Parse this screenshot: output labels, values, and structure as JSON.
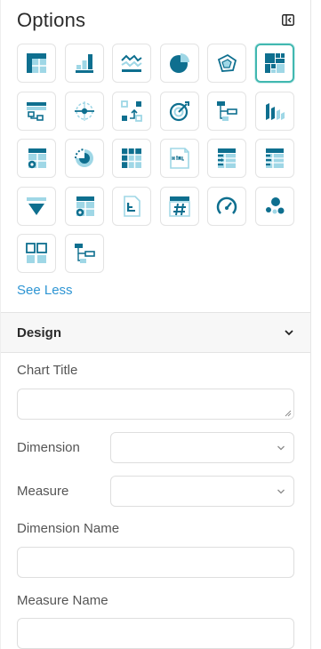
{
  "panel": {
    "title": "Options",
    "collapse_icon": "collapse-panel-icon"
  },
  "chart_types": [
    {
      "icon": "table-icon",
      "selected": false
    },
    {
      "icon": "bar-chart-icon",
      "selected": false
    },
    {
      "icon": "line-chart-icon",
      "selected": false
    },
    {
      "icon": "pie-chart-icon",
      "selected": false
    },
    {
      "icon": "3d-chart-icon",
      "selected": false
    },
    {
      "icon": "treemap-icon",
      "selected": true
    },
    {
      "icon": "table-drilldown-icon",
      "selected": false
    },
    {
      "icon": "radar-chart-icon",
      "selected": false
    },
    {
      "icon": "flow-chart-icon",
      "selected": false
    },
    {
      "icon": "target-chart-icon",
      "selected": false
    },
    {
      "icon": "hierarchy-icon",
      "selected": false
    },
    {
      "icon": "waterfall-3d-icon",
      "selected": false
    },
    {
      "icon": "table-settings-icon",
      "selected": false
    },
    {
      "icon": "radial-chart-icon",
      "selected": false
    },
    {
      "icon": "grid-table-icon",
      "selected": false
    },
    {
      "icon": "html-icon",
      "selected": false
    },
    {
      "icon": "data-table-icon",
      "selected": false
    },
    {
      "icon": "data-table-alt-icon",
      "selected": false
    },
    {
      "icon": "funnel-chart-icon",
      "selected": false
    },
    {
      "icon": "table-config-icon",
      "selected": false
    },
    {
      "icon": "document-icon",
      "selected": false
    },
    {
      "icon": "number-widget-icon",
      "selected": false
    },
    {
      "icon": "gauge-icon",
      "selected": false
    },
    {
      "icon": "bubble-chart-icon",
      "selected": false
    },
    {
      "icon": "compare-layout-icon",
      "selected": false
    },
    {
      "icon": "tree-structure-icon",
      "selected": false
    }
  ],
  "see_less_label": "See Less",
  "design": {
    "title": "Design",
    "chart_title_label": "Chart Title",
    "chart_title_value": "",
    "dimension_label": "Dimension",
    "dimension_value": "",
    "measure_label": "Measure",
    "measure_value": "",
    "dimension_name_label": "Dimension Name",
    "dimension_name_value": "",
    "measure_name_label": "Measure Name",
    "measure_name_value": ""
  },
  "colors": {
    "icon_primary": "#0e6f8f",
    "icon_light": "#9fd7e6",
    "selected_border": "#41b8b0",
    "link": "#2e95d3"
  }
}
